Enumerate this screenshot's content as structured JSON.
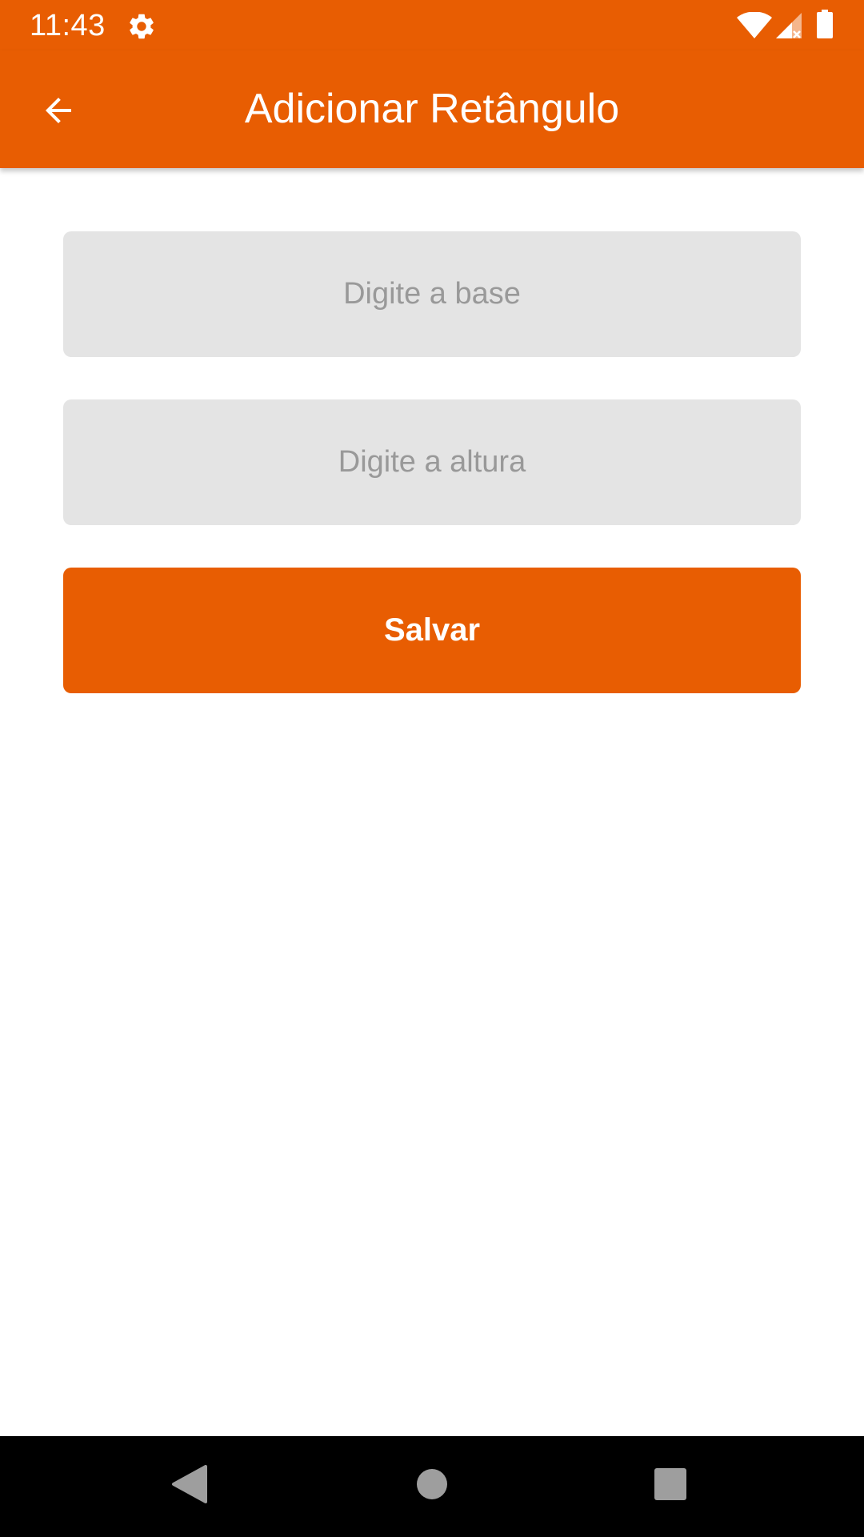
{
  "status_bar": {
    "time": "11:43",
    "icons": [
      "settings-gear-icon",
      "wifi-icon",
      "cell-signal-no-data-icon",
      "battery-full-icon"
    ]
  },
  "app_bar": {
    "title": "Adicionar Retângulo",
    "back_icon": "arrow-back-icon"
  },
  "form": {
    "base_input": {
      "value": "",
      "placeholder": "Digite a base"
    },
    "height_input": {
      "value": "",
      "placeholder": "Digite a altura"
    },
    "save_label": "Salvar"
  },
  "nav_bar": {
    "icons": [
      "nav-back-icon",
      "nav-home-icon",
      "nav-recents-icon"
    ]
  },
  "colors": {
    "accent": "#e85d02",
    "field_background": "#e4e4e4",
    "placeholder": "#999999",
    "nav_background": "#000000",
    "nav_icon": "#9e9e9e"
  }
}
